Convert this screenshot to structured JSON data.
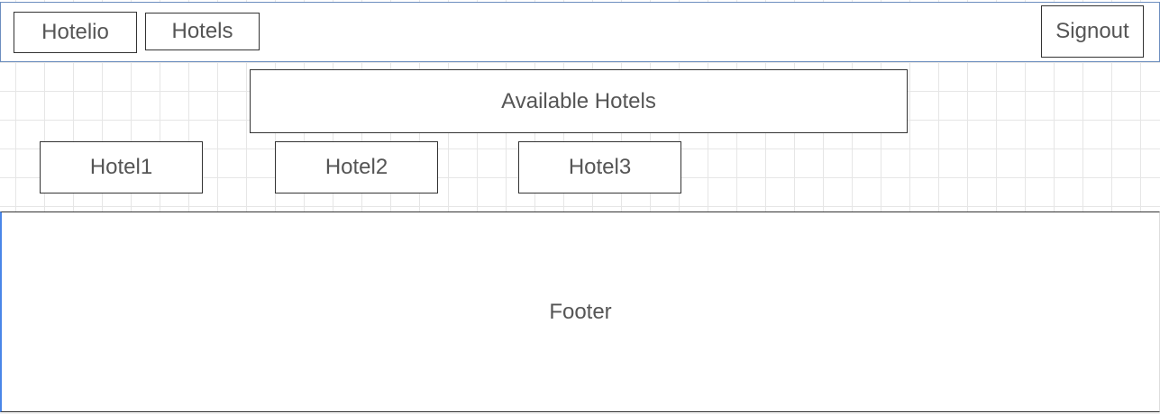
{
  "header": {
    "brand_label": "Hotelio",
    "hotels_label": "Hotels",
    "signout_label": "Signout"
  },
  "main": {
    "title": "Available Hotels",
    "hotels": [
      {
        "label": "Hotel1"
      },
      {
        "label": "Hotel2"
      },
      {
        "label": "Hotel3"
      }
    ]
  },
  "footer": {
    "label": "Footer"
  },
  "colors": {
    "header_border": "#6c8ebf",
    "footer_left_border": "#4a86e8",
    "box_border": "#333333",
    "grid_line": "#e6e6e6",
    "text": "#555555"
  }
}
